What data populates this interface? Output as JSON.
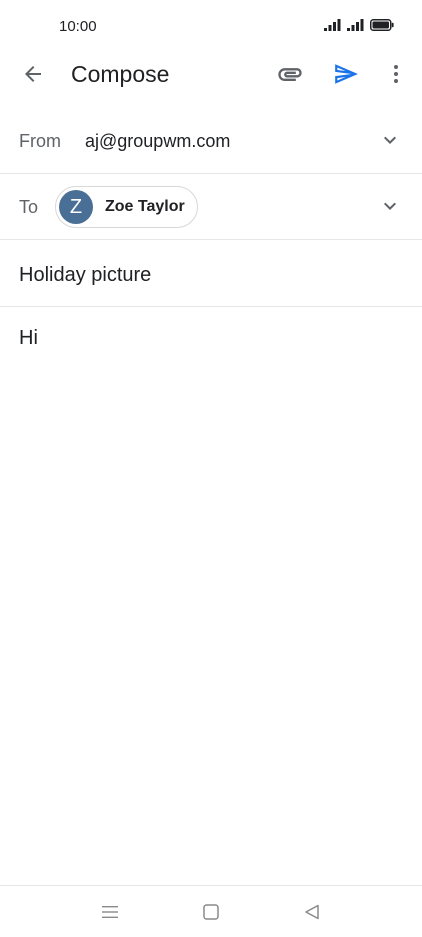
{
  "status_bar": {
    "time": "10:00"
  },
  "app_bar": {
    "title": "Compose"
  },
  "compose": {
    "from_label": "From",
    "from_value": "aj@groupwm.com",
    "to_label": "To",
    "recipient": {
      "initial": "Z",
      "name": "Zoe Taylor"
    },
    "subject": "Holiday picture",
    "body": "Hi"
  },
  "colors": {
    "accent": "#1a73e8",
    "avatar": "#4a6f96",
    "icon": "#5f6368"
  }
}
